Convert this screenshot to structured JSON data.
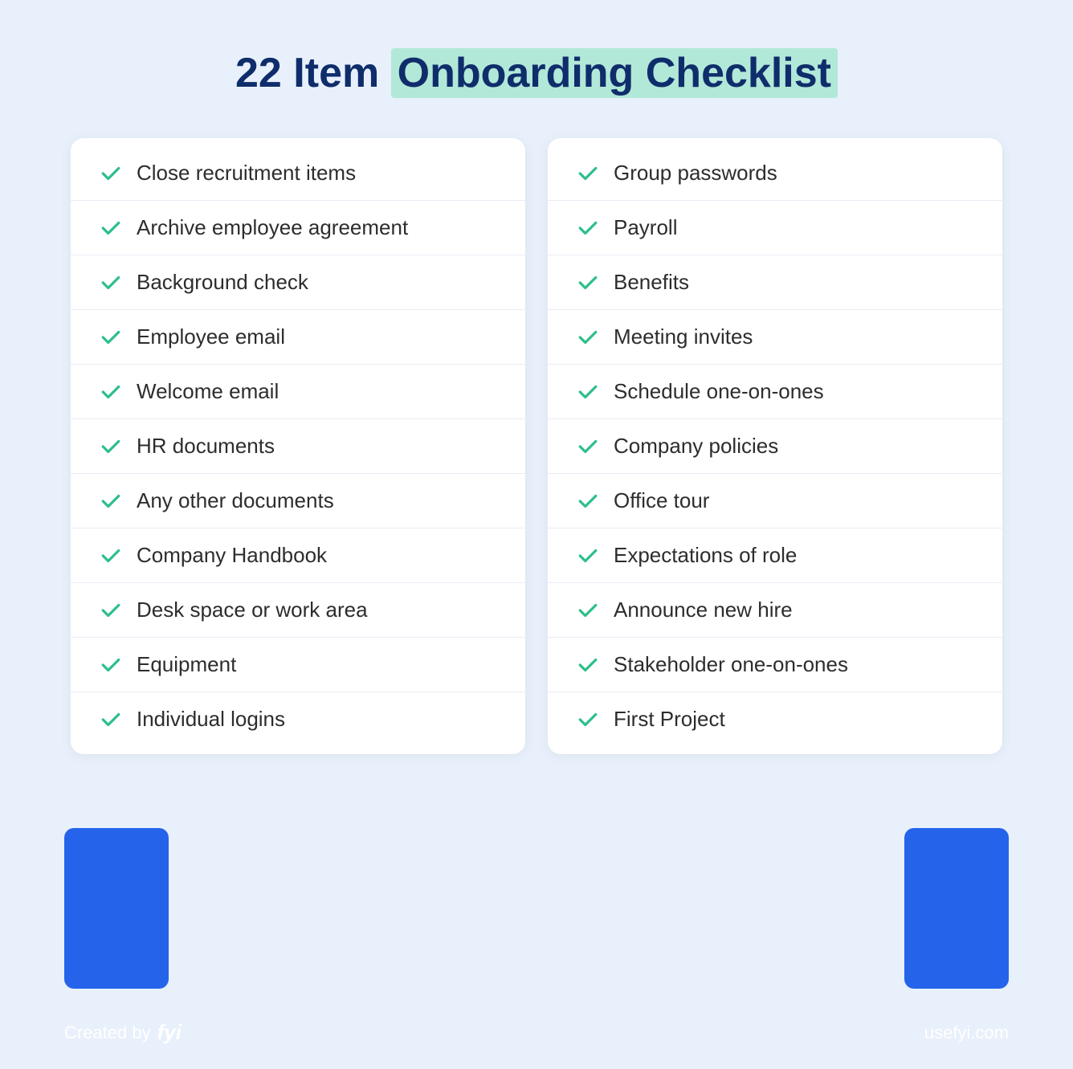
{
  "page": {
    "background_color": "#e8f0fb",
    "title": {
      "prefix": "22 Item ",
      "highlight": "Onboarding Checklist"
    }
  },
  "left_column": {
    "items": [
      "Close recruitment items",
      "Archive employee agreement",
      "Background check",
      "Employee email",
      "Welcome email",
      "HR documents",
      "Any other documents",
      "Company Handbook",
      "Desk space or work area",
      "Equipment",
      "Individual logins"
    ]
  },
  "right_column": {
    "items": [
      "Group passwords",
      "Payroll",
      "Benefits",
      "Meeting invites",
      "Schedule one-on-ones",
      "Company policies",
      "Office tour",
      "Expectations of role",
      "Announce new hire",
      "Stakeholder one-on-ones",
      "First Project"
    ]
  },
  "footer": {
    "created_by_label": "Created by",
    "logo_text": "fyi",
    "website": "usefyi.com"
  }
}
